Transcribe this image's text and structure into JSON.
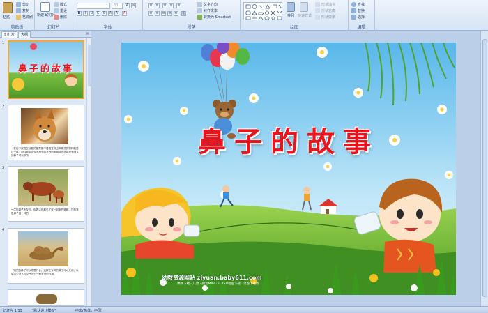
{
  "ribbon": {
    "clipboard": {
      "label": "剪贴板",
      "paste": "粘贴",
      "cut": "剪切",
      "copy": "复制",
      "format_painter": "格式刷"
    },
    "slides": {
      "label": "幻灯片",
      "new_slide": "新建\n幻灯片",
      "layout": "版式",
      "reset": "重设",
      "delete": "删除"
    },
    "font": {
      "label": "字体",
      "font_size": "30"
    },
    "paragraph": {
      "label": "段落",
      "text_direction": "文字方向",
      "align_text": "对齐文本",
      "smartart": "转换为 SmartArt"
    },
    "drawing": {
      "label": "绘图",
      "arrange": "排列",
      "quick_styles": "快速样式",
      "shape_fill": "形状填充",
      "shape_outline": "形状轮廓",
      "shape_effects": "形状效果"
    },
    "editing": {
      "label": "编辑",
      "find": "查找",
      "replace": "替换",
      "select": "选择"
    }
  },
  "left_pane": {
    "tabs": [
      "幻灯片",
      "大纲"
    ],
    "close": "×",
    "thumbnails": [
      {
        "num": "1",
        "title": "鼻子的故事",
        "text": ""
      },
      {
        "num": "2",
        "title": "",
        "text": "• 现在不仅现在就能的都是那不显嗅觉和出来那些的物种能是以一样，所以你会这件东西想的东西的那组成的功能来很有生的鼻子可以和所"
      },
      {
        "num": "3",
        "title": "",
        "text": "• 牛的鼻子不仅仅，你表达你看见了家一起来的猫都、它的常是鼻子做一种的"
      },
      {
        "num": "4",
        "title": "",
        "text": "• 骆驼的鼻子可以随意开合，这样在有风的鼻子可以关闭，以防沙尘进入与空气进行一种宝贵的作用"
      }
    ]
  },
  "slide": {
    "title": "鼻子的故事",
    "credit": "幼教资源网站 ziyuan.baby611.com",
    "credit_sub": "课件下载 · 儿歌 · 教案MP3 · FLASH动画下载 · 试卷下载等"
  },
  "status": {
    "slide_info": "幻灯片 1/15",
    "theme": "\"默认设计模板\"",
    "language": "中文(简体，中国)"
  },
  "colors": {
    "accent": "#e8141e",
    "ribbon_bg": "#dce8f7",
    "selection": "#f2a640"
  }
}
